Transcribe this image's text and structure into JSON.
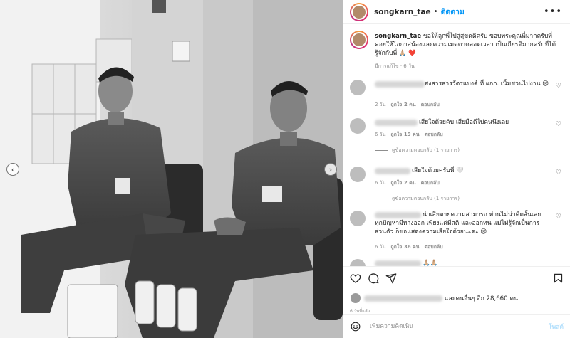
{
  "post": {
    "username": "songkarn_tae",
    "follow_label": "ติดตาม",
    "more_icon": "more-dots-icon",
    "caption": {
      "username": "songkarn_tae",
      "text": "ขอให้ลูกพี่ไปสู่สุขคติครับ ขอบพระคุณพี่มากครับที่คอยให้โอกาสน้องและความเมตตาตลอดเวลา เป็นเกียรติมากครับที่ได้รู้จักกับพี่ 🙏🏼 ❤️",
      "meta": "มีการแก้ไข · 6 วัน"
    },
    "comments": [
      {
        "text": "สงสารสารวัตรแบงค์ ที่ ผกก. เนิ้มชวนไปงาน 😢",
        "time": "2 วัน",
        "likes": "ถูกใจ 2 คน",
        "reply": "ตอบกลับ"
      },
      {
        "text": "เสียใจด้วยคับ เสียมือดีไปคนนึงเลย",
        "time": "6 วัน",
        "likes": "ถูกใจ 19 คน",
        "reply": "ตอบกลับ",
        "view_replies": "ดูข้อความตอบกลับ (1 รายการ)"
      },
      {
        "text": "เสียใจด้วยครับพี่ 🤍",
        "time": "6 วัน",
        "likes": "ถูกใจ 2 คน",
        "reply": "ตอบกลับ",
        "view_replies": "ดูข้อความตอบกลับ (1 รายการ)"
      },
      {
        "text": "น่าเสียดายความสามารถ ท่านไม่น่าคิดสั้นเลย ทุกปัญหามีทางออก เพียงแค่มีสติ และออกทน แม่ไม่รู้จักเป็นการส่วนตัว ก็ขอแสดงความเสียใจด้วยนะคะ 😢",
        "time": "6 วัน",
        "likes": "ถูกใจ 36 คน",
        "reply": "ตอบกลับ"
      },
      {
        "text": "🙏🏼🙏🏼"
      }
    ],
    "likes_text": "และคนอื่นๆ อีก 28,660 คน",
    "time_ago": "6 วันที่แล้ว",
    "add_comment_placeholder": "เพิ่มความคิดเห็น",
    "post_button": "โพสต์"
  }
}
